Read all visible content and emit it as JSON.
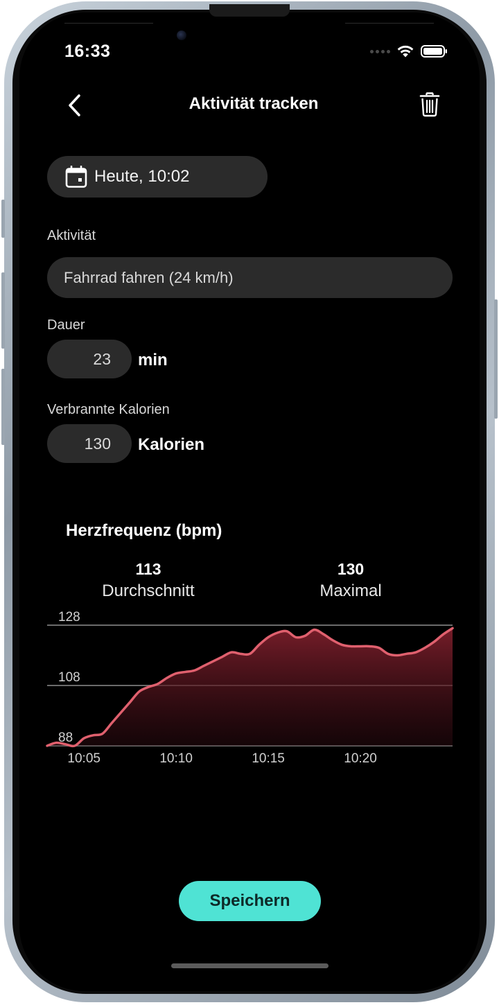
{
  "status_bar": {
    "time": "16:33"
  },
  "header": {
    "title": "Aktivität tracken"
  },
  "date_selector": {
    "label": "Heute, 10:02"
  },
  "activity": {
    "label": "Aktivität",
    "value": "Fahrrad fahren (24 km/h)"
  },
  "duration": {
    "label": "Dauer",
    "value": "23",
    "unit": "min"
  },
  "calories": {
    "label": "Verbrannte Kalorien",
    "value": "130",
    "unit": "Kalorien"
  },
  "heart_rate": {
    "title": "Herzfrequenz (bpm)",
    "average": {
      "value": "113",
      "label": "Durchschnitt"
    },
    "maximum": {
      "value": "130",
      "label": "Maximal"
    }
  },
  "save_button": {
    "label": "Speichern"
  },
  "colors": {
    "accent": "#4fe3d4",
    "chart_line": "#e0606e",
    "background": "#000000",
    "field_bg": "#2b2b2b"
  },
  "chart_data": {
    "type": "area",
    "title": "Herzfrequenz (bpm)",
    "xlabel": "",
    "ylabel": "",
    "x_tick_labels": [
      "10:05",
      "10:10",
      "10:15",
      "10:20"
    ],
    "y_tick_labels": [
      "88",
      "108",
      "128"
    ],
    "ylim": [
      88,
      128
    ],
    "grid": true,
    "series": [
      {
        "x": [
          3.0,
          3.5,
          4.0,
          4.5,
          5.0,
          5.5,
          6.0,
          6.5,
          7.0,
          7.5,
          8.0,
          8.5,
          9.0,
          9.5,
          10.0,
          10.5,
          11.0,
          11.5,
          12.0,
          12.5,
          13.0,
          13.5,
          14.0,
          14.5,
          15.0,
          15.5,
          16.0,
          16.5,
          17.0,
          17.5,
          18.0,
          18.5,
          19.0,
          19.5,
          20.0,
          20.5,
          21.0,
          21.5,
          22.0,
          22.5,
          23.0,
          23.5,
          24.0,
          24.5,
          25.0
        ],
        "y": [
          88,
          89,
          88.5,
          88,
          90.5,
          91.5,
          92,
          95.5,
          99,
          102.5,
          106,
          107.5,
          108.5,
          110.5,
          112,
          112.5,
          113,
          114.5,
          116,
          117.5,
          119,
          118.5,
          118.5,
          121.5,
          124,
          125.5,
          126,
          124,
          124.5,
          126.5,
          125,
          123,
          121.5,
          121,
          121,
          121,
          120.5,
          118.5,
          118,
          118.5,
          119,
          120.5,
          122.5,
          125,
          127
        ]
      }
    ]
  }
}
